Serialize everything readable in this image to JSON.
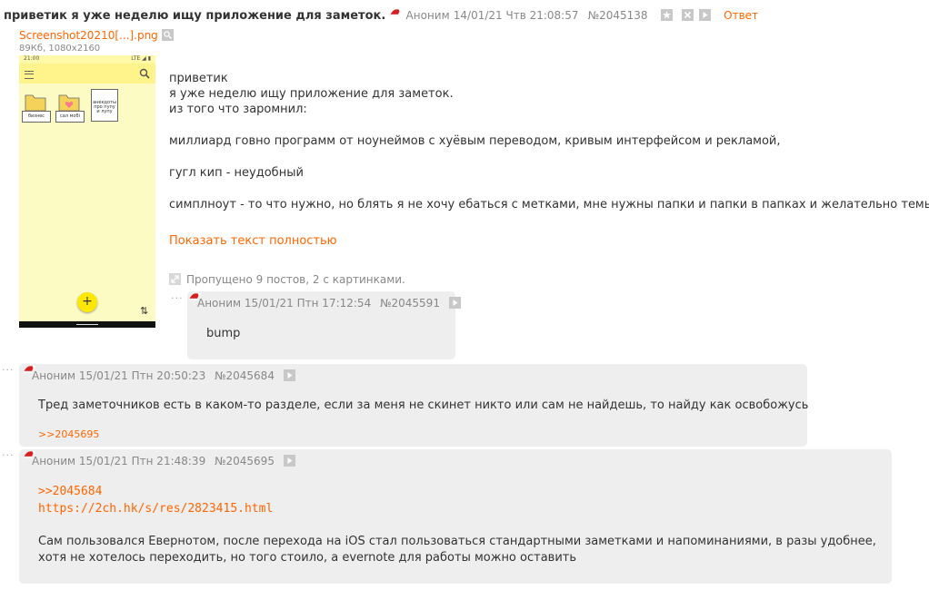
{
  "op": {
    "title": "приветик я уже неделю ищу приложение для заметок.",
    "author": "Аноним",
    "date": "14/01/21 Чтв 21:08:57",
    "number": "№2045138",
    "reply_label": "Ответ",
    "file": {
      "name": "Screenshot20210[...].png",
      "meta": "89Кб, 1080x2160",
      "thumb": {
        "status_time": "21:00",
        "status_right": "LTE ◢ ▮",
        "folders": [
          "бизнес",
          "сал мобі",
          "анекдоты про пупу и лупу"
        ],
        "fab": "+",
        "sort": "⇅"
      }
    },
    "text": [
      "приветик",
      "я уже неделю ищу приложение для заметок.",
      "из того что заромнил:",
      "",
      "миллиард говно программ от ноунеймов с хуёвым переводом, кривым интерфейсом и рекламой,",
      "",
      "гугл кип - неудобный",
      "",
      "симплноут - то что нужно, но блять я не хочу ебаться с метками, мне нужны папки и папки в папках и желательно темы"
    ],
    "show_full": "Показать текст полностью",
    "skipped": "Пропущено 9 постов, 2 с картинками."
  },
  "replies": [
    {
      "author": "Аноним",
      "date": "15/01/21 Птн 17:12:54",
      "number": "№2045591",
      "text": "bump"
    },
    {
      "author": "Аноним",
      "date": "15/01/21 Птн 20:50:23",
      "number": "№2045684",
      "text": "Тред заметочников есть в каком-то разделе, если за меня не скинет никто или сам не найдешь, то найду как освобожусь",
      "backlink": ">>2045695"
    },
    {
      "author": "Аноним",
      "date": "15/01/21 Птн 21:48:39",
      "number": "№2045695",
      "quote_link": ">>2045684",
      "url": "https://2ch.hk/s/res/2823415.html",
      "text1": "Сам пользовался Евернотом, после перехода на iOS стал пользоваться стандартными заметками и напоминаниями, в разы удобнее,",
      "text2": "хотя не хотелось переходить, но того стоило, а evernote для работы можно оставить"
    }
  ],
  "colors": {
    "accent": "#ff6600",
    "reply_bg": "#eeeeee",
    "meta": "#888888"
  }
}
